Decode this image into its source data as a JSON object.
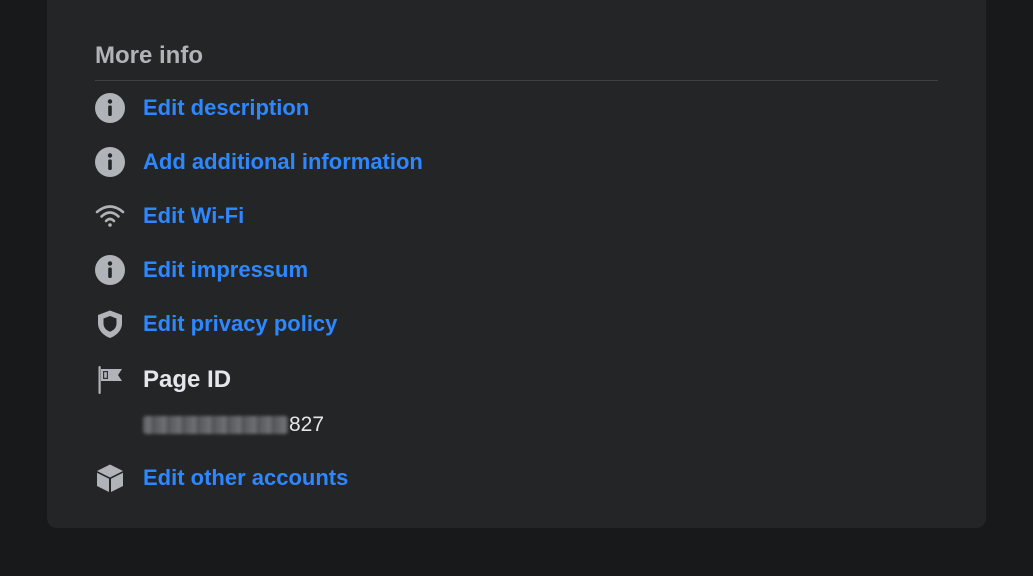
{
  "section": {
    "title": "More info"
  },
  "items": {
    "edit_description": {
      "label": "Edit description",
      "icon": "info-icon"
    },
    "add_additional_information": {
      "label": "Add additional information",
      "icon": "info-icon"
    },
    "edit_wifi": {
      "label": "Edit Wi-Fi",
      "icon": "wifi-icon"
    },
    "edit_impressum": {
      "label": "Edit impressum",
      "icon": "info-icon"
    },
    "edit_privacy_policy": {
      "label": "Edit privacy policy",
      "icon": "shield-icon"
    },
    "edit_other_accounts": {
      "label": "Edit other accounts",
      "icon": "cube-icon"
    }
  },
  "page_id": {
    "label": "Page ID",
    "icon": "flag-icon",
    "visible_suffix": "827"
  },
  "colors": {
    "page_background": "#18191a",
    "card_background": "#242526",
    "link": "#2d88ff",
    "icon": "#b0b3b8",
    "heading": "#b0b3b8",
    "text_primary": "#e4e6eb",
    "divider": "#3e4042"
  }
}
